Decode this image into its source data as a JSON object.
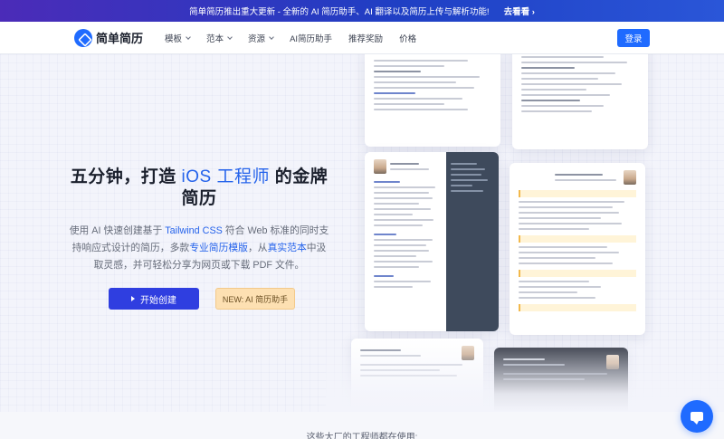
{
  "announcement": {
    "text": "简单简历推出重大更新 - 全新的 AI 简历助手、AI 翻译以及简历上传与解析功能!",
    "link": "去看看 ›"
  },
  "nav": {
    "logo_text": "简单简历",
    "items": [
      {
        "label": "模板",
        "dropdown": true
      },
      {
        "label": "范本",
        "dropdown": true
      },
      {
        "label": "资源",
        "dropdown": true
      },
      {
        "label": "AI简历助手",
        "dropdown": false
      },
      {
        "label": "推荐奖励",
        "dropdown": false
      },
      {
        "label": "价格",
        "dropdown": false
      }
    ],
    "login": "登录"
  },
  "hero": {
    "title_pre": "五分钟，打造",
    "title_accent": "iOS 工程师",
    "title_post": "的金牌简历",
    "desc": {
      "p1": "使用 AI 快速创建基于",
      "tailwind": "Tailwind CSS",
      "p2": "符合 Web 标准的同时支持响应式设计的简历，多款",
      "templates": "专业简历模版",
      "p3": "，从",
      "samples": "真实范本",
      "p4": "中汲取灵感，并可轻松分享为网页或下载 PDF 文件。"
    },
    "start_button": "开始创建",
    "ai_button": "NEW: AI 简历助手"
  },
  "users_caption": "这些大厂的工程师都在使用:",
  "colors": {
    "primary": "#1f6bff",
    "cta": "#2f3ee0",
    "accent_text": "#2563eb",
    "ai_button_bg": "#fde0b2"
  }
}
